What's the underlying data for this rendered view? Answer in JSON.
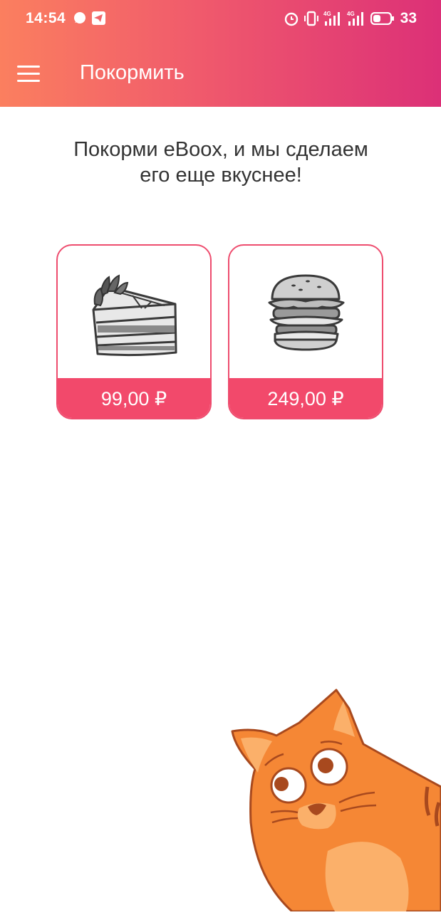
{
  "status_bar": {
    "time": "14:54",
    "battery": "33",
    "icons": [
      "chat-bubble-icon",
      "telegram-icon",
      "alarm-icon",
      "vibrate-icon",
      "signal-4g-icon",
      "signal-4g-icon",
      "battery-icon"
    ]
  },
  "app_bar": {
    "title": "Покормить",
    "menu_icon": "menu-icon",
    "gradient": [
      "#fb7f5f",
      "#dc3077"
    ]
  },
  "intro": {
    "line1": "Покорми eBoox, и мы сделаем",
    "line2": "его еще вкуснее!"
  },
  "products": [
    {
      "icon": "cake-icon",
      "price": "99,00 ₽"
    },
    {
      "icon": "burger-icon",
      "price": "249,00 ₽"
    }
  ],
  "colors": {
    "accent": "#f2496b",
    "text": "#333333",
    "cat": "#f58735"
  },
  "mascot": "cat-mascot"
}
